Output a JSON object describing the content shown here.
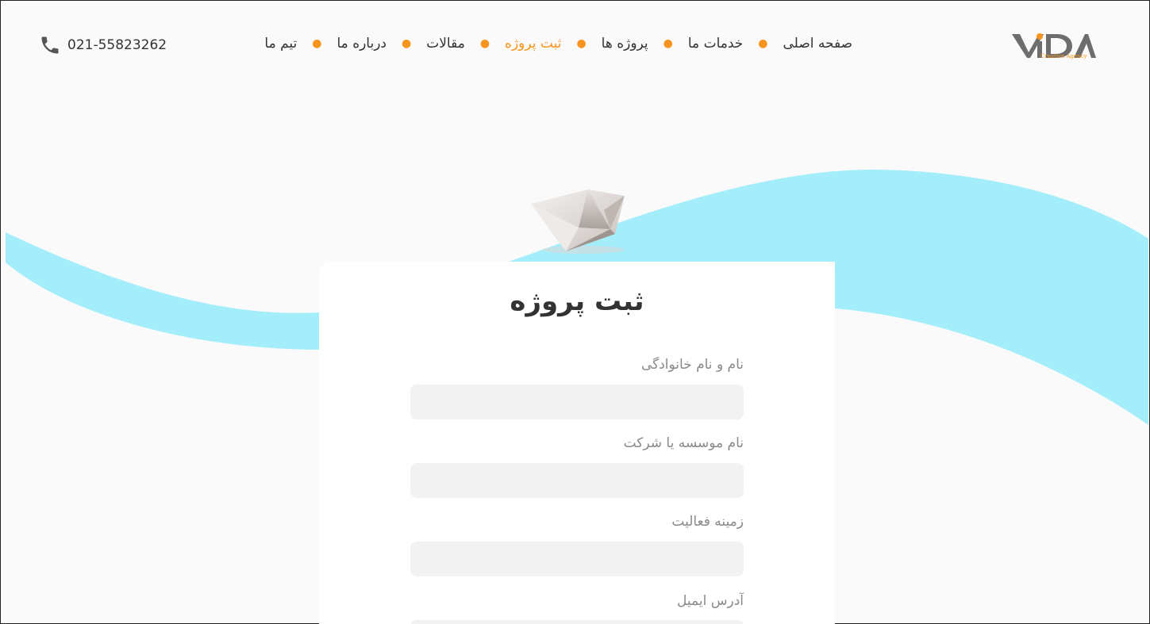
{
  "brand": {
    "logo_text": "ViDA",
    "logo_sub": "Creative Agency",
    "accent_color": "#f7941d",
    "wave_color": "#a4eefc"
  },
  "nav": {
    "items": [
      {
        "label": "صفحه اصلی",
        "active": false
      },
      {
        "label": "خدمات ما",
        "active": false
      },
      {
        "label": "پروژه ها",
        "active": false
      },
      {
        "label": "ثبت پروژه",
        "active": true
      },
      {
        "label": "مقالات",
        "active": false
      },
      {
        "label": "درباره ما",
        "active": false
      },
      {
        "label": "تیم ما",
        "active": false
      }
    ]
  },
  "contact": {
    "icon": "phone-icon",
    "phone": "021-55823262"
  },
  "form": {
    "title": "ثبت پروژه",
    "fields": [
      {
        "label": "نام و نام خانوادگی",
        "value": "",
        "placeholder": ""
      },
      {
        "label": "نام موسسه یا شرکت",
        "value": "",
        "placeholder": ""
      },
      {
        "label": "زمینه فعالیت",
        "value": "",
        "placeholder": ""
      },
      {
        "label": "آدرس ایمیل",
        "value": "",
        "placeholder": ""
      }
    ]
  }
}
